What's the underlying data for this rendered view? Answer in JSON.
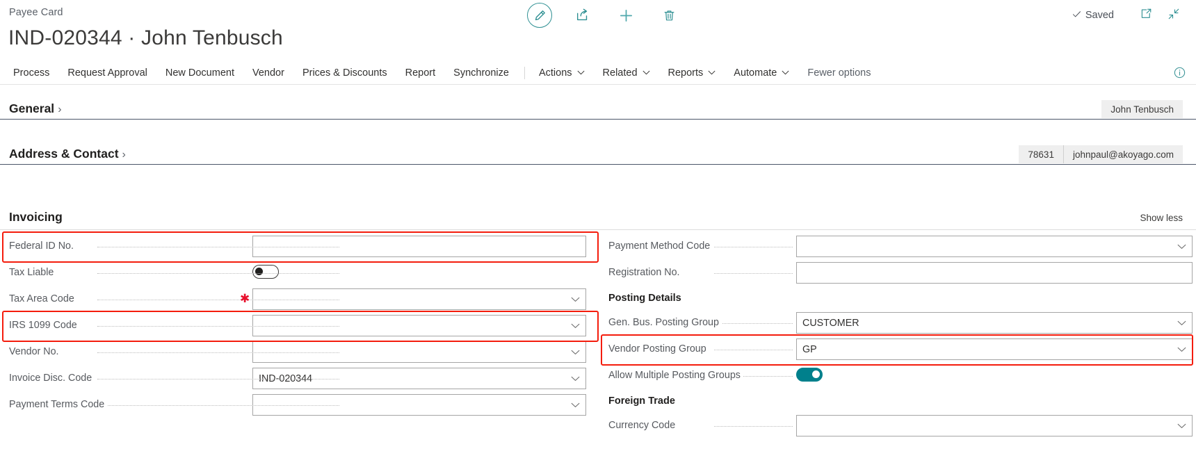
{
  "header": {
    "breadcrumb": "Payee Card",
    "title": "IND-020344 · John Tenbusch",
    "saved_label": "Saved",
    "toolbar": [
      {
        "name": "edit-icon",
        "label": "Edit"
      },
      {
        "name": "share-icon",
        "label": "Share"
      },
      {
        "name": "plus-icon",
        "label": "New"
      },
      {
        "name": "trash-icon",
        "label": "Delete"
      }
    ],
    "window_actions": [
      {
        "name": "open-in-new-window-icon",
        "label": "Open in new window"
      },
      {
        "name": "collapse-icon",
        "label": "Minimize"
      }
    ]
  },
  "menubar": {
    "items": [
      {
        "label": "Process",
        "caret": false,
        "muted": false
      },
      {
        "label": "Request Approval",
        "caret": false,
        "muted": false
      },
      {
        "label": "New Document",
        "caret": false,
        "muted": false
      },
      {
        "label": "Vendor",
        "caret": false,
        "muted": false
      },
      {
        "label": "Prices & Discounts",
        "caret": false,
        "muted": false
      },
      {
        "label": "Report",
        "caret": false,
        "muted": false
      },
      {
        "label": "Synchronize",
        "caret": false,
        "muted": false
      },
      {
        "label": "Actions",
        "caret": true,
        "muted": false
      },
      {
        "label": "Related",
        "caret": true,
        "muted": false
      },
      {
        "label": "Reports",
        "caret": true,
        "muted": false
      },
      {
        "label": "Automate",
        "caret": true,
        "muted": false
      },
      {
        "label": "Fewer options",
        "caret": false,
        "muted": true
      }
    ],
    "info_icon": "info-icon"
  },
  "sections": {
    "general": {
      "title": "General",
      "chevron": "›",
      "pills": [
        "John Tenbusch"
      ]
    },
    "address_contact": {
      "title": "Address & Contact",
      "chevron": "›",
      "pills": [
        "78631",
        "johnpaul@akoyago.com"
      ]
    },
    "invoicing": {
      "title": "Invoicing",
      "show_less": "Show less"
    }
  },
  "form": {
    "left": [
      {
        "type": "input",
        "label": "Federal ID No.",
        "value": "",
        "dropdown": false,
        "required": false,
        "highlight": true
      },
      {
        "type": "toggle",
        "label": "Tax Liable",
        "on": false,
        "required": false,
        "highlight": false
      },
      {
        "type": "input",
        "label": "Tax Area Code",
        "value": "",
        "dropdown": true,
        "required": true,
        "highlight": false
      },
      {
        "type": "input",
        "label": "IRS 1099 Code",
        "value": "",
        "dropdown": true,
        "required": false,
        "highlight": true
      },
      {
        "type": "input",
        "label": "Vendor No.",
        "value": "",
        "dropdown": true,
        "required": false,
        "highlight": false
      },
      {
        "type": "input",
        "label": "Invoice Disc. Code",
        "value": "IND-020344",
        "dropdown": true,
        "required": false,
        "highlight": false
      },
      {
        "type": "input",
        "label": "Payment Terms Code",
        "value": "",
        "dropdown": true,
        "required": false,
        "highlight": false
      }
    ],
    "right": [
      {
        "type": "input",
        "label": "Payment Method Code",
        "value": "",
        "dropdown": true,
        "highlight": false
      },
      {
        "type": "input",
        "label": "Registration No.",
        "value": "",
        "dropdown": false,
        "highlight": false
      },
      {
        "type": "subhead",
        "label": "Posting Details"
      },
      {
        "type": "input",
        "label": "Gen. Bus. Posting Group",
        "value": "CUSTOMER",
        "dropdown": true,
        "highlight": false
      },
      {
        "type": "input",
        "label": "Vendor Posting Group",
        "value": "GP",
        "dropdown": true,
        "highlight": true
      },
      {
        "type": "toggle",
        "label": "Allow Multiple Posting Groups",
        "on": true,
        "highlight": false
      },
      {
        "type": "subhead",
        "label": "Foreign Trade"
      },
      {
        "type": "input",
        "label": "Currency Code",
        "value": "",
        "dropdown": true,
        "highlight": false
      }
    ]
  },
  "colors": {
    "accent": "#2d8f92",
    "toggle_on": "#00808c",
    "highlight": "#f41c0c",
    "required": "#e8112d",
    "section_rule": "#4a5568"
  }
}
